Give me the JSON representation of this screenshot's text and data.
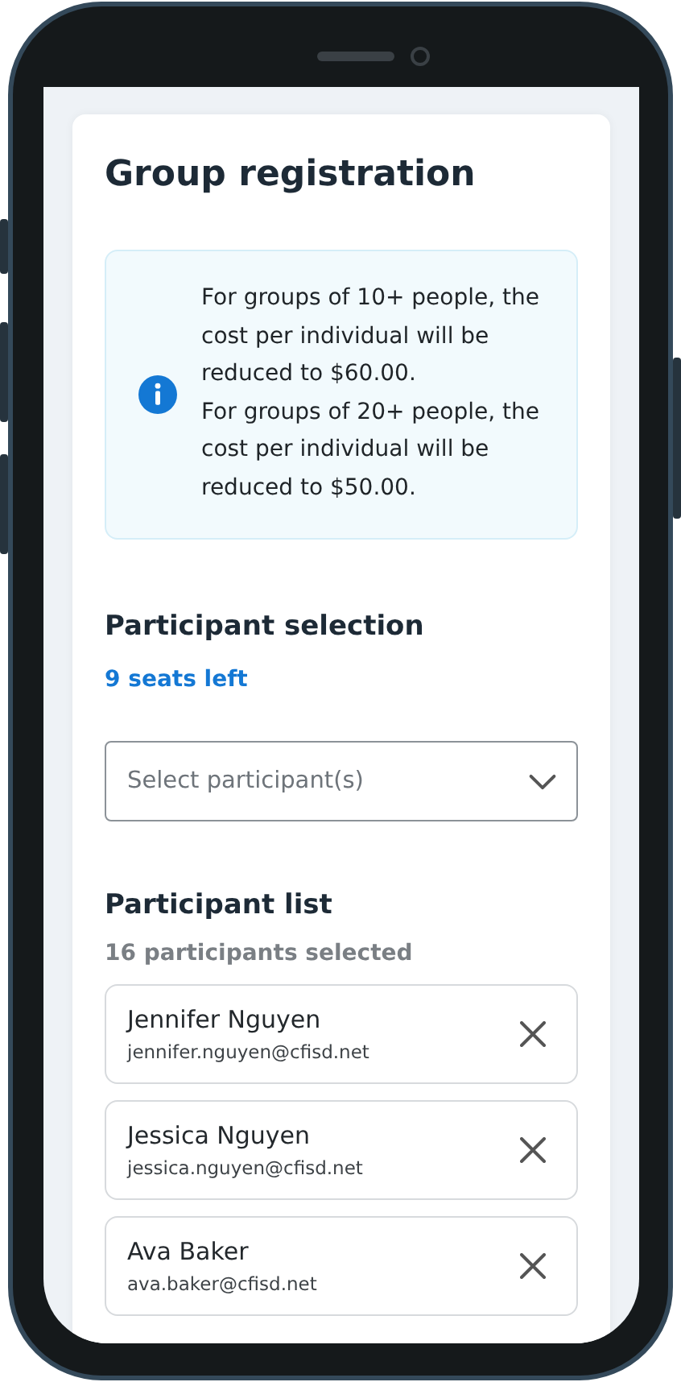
{
  "title": "Group registration",
  "notice": {
    "paragraphs": [
      "For groups of 10+ people, the cost per individual will be reduced to $60.00.",
      "For groups of 20+ people, the cost per individual will be reduced to $50.00."
    ]
  },
  "selection": {
    "heading": "Participant selection",
    "seats": "9 seats left",
    "dropdown": {
      "placeholder": "Select participant(s)"
    }
  },
  "participant_list": {
    "heading": "Participant list",
    "count": "16 participants selected",
    "participants": [
      {
        "name": "Jennifer Nguyen",
        "email": "jennifer.nguyen@cfisd.net"
      },
      {
        "name": "Jessica Nguyen",
        "email": "jessica.nguyen@cfisd.net"
      },
      {
        "name": "Ava Baker",
        "email": "ava.baker@cfisd.net"
      }
    ]
  }
}
